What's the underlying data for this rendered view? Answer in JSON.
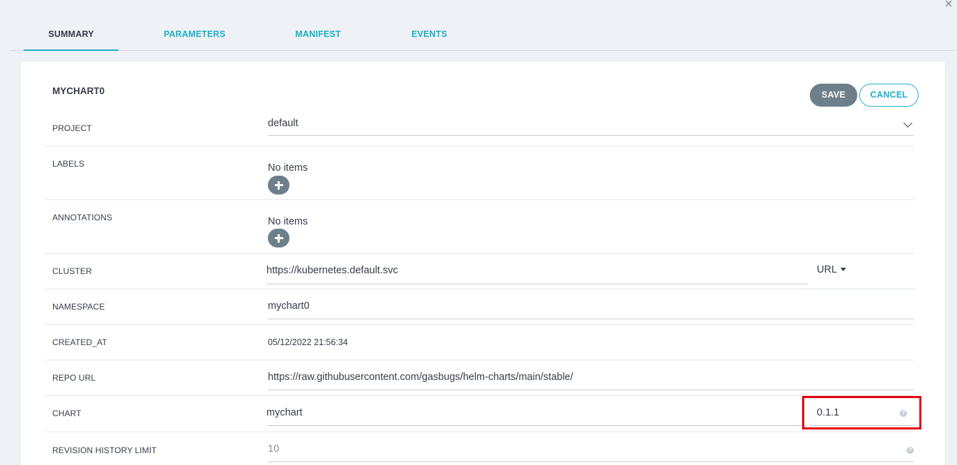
{
  "window": {
    "close_icon": "×"
  },
  "tabs": [
    {
      "label": "SUMMARY",
      "active": true
    },
    {
      "label": "PARAMETERS"
    },
    {
      "label": "MANIFEST"
    },
    {
      "label": "EVENTS"
    }
  ],
  "app": {
    "name": "MYCHART0"
  },
  "actions": {
    "save": "SAVE",
    "cancel": "CANCEL"
  },
  "fields": {
    "project": {
      "label": "PROJECT",
      "value": "default"
    },
    "labels": {
      "label": "LABELS",
      "empty": "No items"
    },
    "annotations": {
      "label": "ANNOTATIONS",
      "empty": "No items"
    },
    "cluster": {
      "label": "CLUSTER",
      "value": "https://kubernetes.default.svc",
      "type": "URL"
    },
    "namespace": {
      "label": "NAMESPACE",
      "value": "mychart0"
    },
    "created_at": {
      "label": "CREATED_AT",
      "value": "05/12/2022 21:56:34"
    },
    "repo_url": {
      "label": "REPO URL",
      "value": "https://raw.githubusercontent.com/gasbugs/helm-charts/main/stable/"
    },
    "chart": {
      "label": "CHART",
      "value": "mychart",
      "version": "0.1.1"
    },
    "revision_history_limit": {
      "label": "REVISION HISTORY LIMIT",
      "placeholder": "10"
    }
  },
  "help_icon": "?",
  "colors": {
    "accent": "#1bafc9",
    "button_grey": "#6d7f8b",
    "highlight": "#e3000f",
    "background": "#eef1f5"
  }
}
